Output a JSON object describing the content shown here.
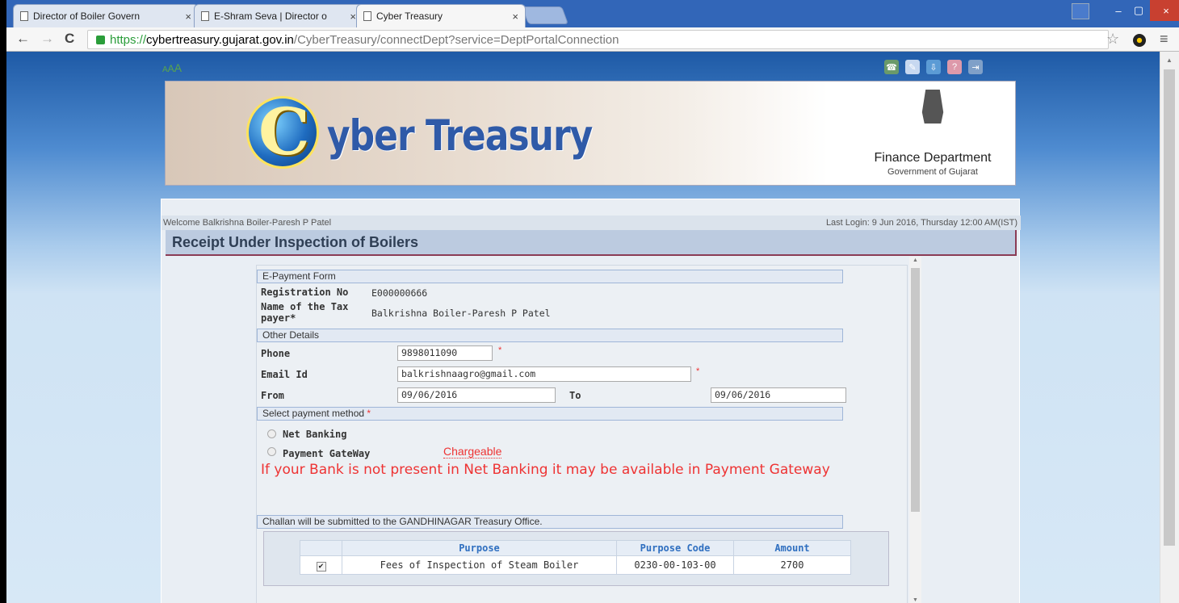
{
  "browser": {
    "tabs": [
      {
        "title": "Director of Boiler Govern"
      },
      {
        "title": "E-Shram Seva | Director o"
      },
      {
        "title": "Cyber Treasury",
        "active": true
      }
    ],
    "url_scheme": "https://",
    "url_host": "cybertreasury.gujarat.gov.in",
    "url_path": "/CyberTreasury/connectDept?service=DeptPortalConnection",
    "icons": {
      "back": "←",
      "forward": "→",
      "reload": "C",
      "star": "☆",
      "menu": "≡",
      "close": "×",
      "minimize": "–",
      "maximize": "▢"
    }
  },
  "header": {
    "font_size_controls": [
      "A",
      "A",
      "A"
    ],
    "brand_initial": "C",
    "brand_text": "yber Treasury",
    "department": "Finance Department",
    "government": "Government of Gujarat"
  },
  "welcome_bar": {
    "welcome": "Welcome Balkrishna Boiler-Paresh P Patel",
    "last_login": "Last Login: 9 Jun 2016, Thursday 12:00 AM(IST)"
  },
  "page_title": "Receipt Under Inspection of Boilers",
  "form": {
    "sections": {
      "epayment": "E-Payment Form",
      "other": "Other Details",
      "payment_method": "Select payment method"
    },
    "registration_label": "Registration No",
    "registration_value": "E000000666",
    "taxpayer_label_1": "Name of the Tax",
    "taxpayer_label_2": "payer*",
    "taxpayer_value": "Balkrishna Boiler-Paresh P Patel",
    "phone_label": "Phone",
    "phone_value": "9898011090",
    "email_label": "Email Id",
    "email_value": "balkrishnaagro@gmail.com",
    "from_label": "From",
    "from_value": "09/06/2016",
    "to_label": "To",
    "to_value": "09/06/2016",
    "required_mark": "*",
    "net_banking": "Net Banking",
    "payment_gateway": "Payment GateWay",
    "chargeable": "Chargeable",
    "warning": "If your Bank is not present in Net Banking it may be available in Payment Gateway",
    "challan_note": "Challan will be submitted to the GANDHINAGAR Treasury Office."
  },
  "purpose_table": {
    "headers": [
      "",
      "Purpose",
      "Purpose Code",
      "Amount"
    ],
    "rows": [
      {
        "checked": "✔",
        "purpose": "Fees of Inspection of Steam Boiler",
        "code": "0230-00-103-00",
        "amount": "2700"
      }
    ]
  }
}
